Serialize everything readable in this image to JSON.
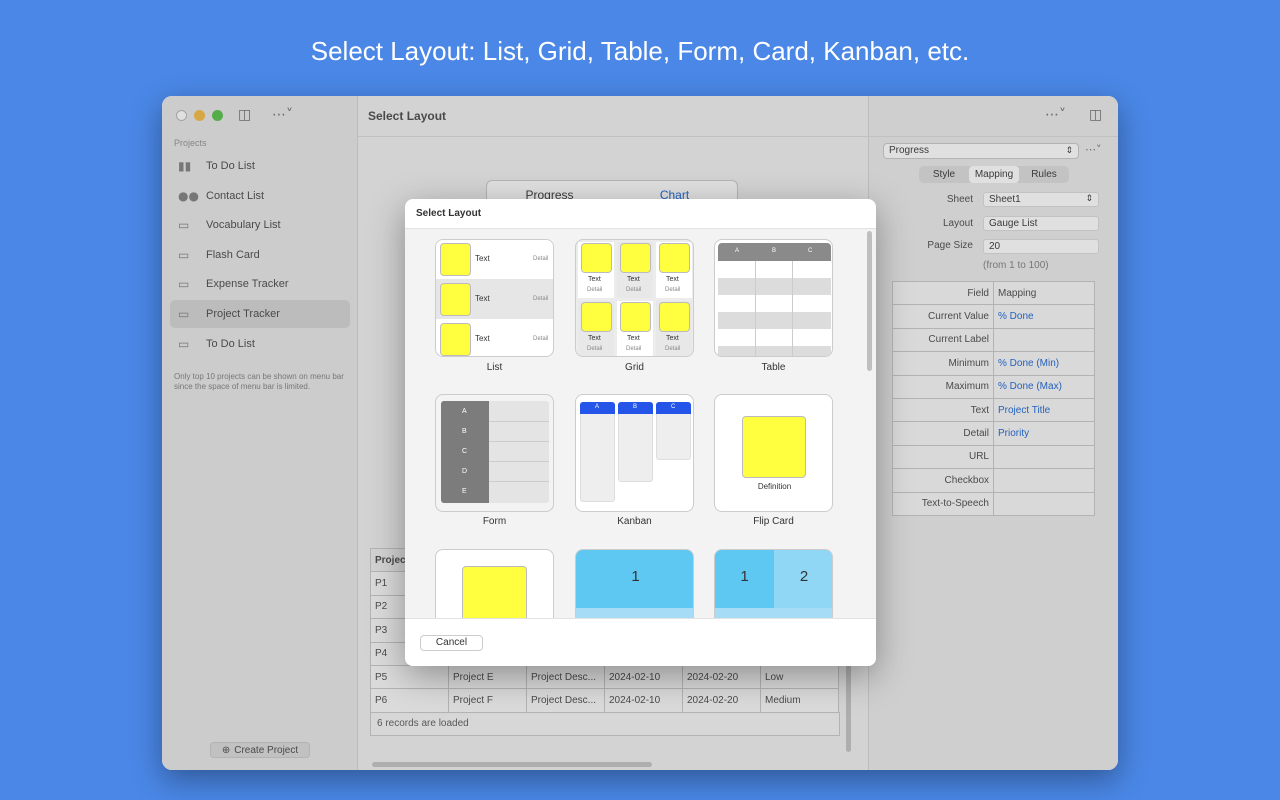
{
  "headline": "Select Layout: List, Grid, Table, Form, Card, Kanban, etc.",
  "colors": {
    "background": "#4a87e6",
    "accent": "#2a6fd6",
    "yellow": "#ffff3f",
    "kanban_header": "#2455e8",
    "card_blue": "#5ec7f2"
  },
  "titlebar_icons": [
    "sidebar-toggle-icon",
    "more-options-icon",
    "inspector-toggle-icon"
  ],
  "sidebar": {
    "section": "Projects",
    "items": [
      {
        "label": "To Do List",
        "icon": "bar-chart-icon"
      },
      {
        "label": "Contact List",
        "icon": "people-icon"
      },
      {
        "label": "Vocabulary List",
        "icon": "folder-icon"
      },
      {
        "label": "Flash Card",
        "icon": "folder-icon"
      },
      {
        "label": "Expense Tracker",
        "icon": "folder-icon"
      },
      {
        "label": "Project Tracker",
        "icon": "folder-icon",
        "selected": true
      },
      {
        "label": "To Do List",
        "icon": "folder-icon"
      }
    ],
    "note": "Only top 10 projects can be shown on menu bar since the space of menu bar is limited.",
    "create_button": "Create Project"
  },
  "main": {
    "title": "Select Layout",
    "segments": [
      "Progress",
      "Chart"
    ],
    "table": {
      "header": "Project",
      "rows": [
        [
          "P1",
          "",
          "",
          "",
          "",
          ""
        ],
        [
          "P2",
          "",
          "",
          "",
          "",
          ""
        ],
        [
          "P3",
          "",
          "",
          "",
          "",
          ""
        ],
        [
          "P4",
          "",
          "",
          "",
          "",
          ""
        ],
        [
          "P5",
          "Project E",
          "Project Desc...",
          "2024-02-10",
          "2024-02-20",
          "Low"
        ],
        [
          "P6",
          "Project F",
          "Project Desc...",
          "2024-02-10",
          "2024-02-20",
          "Medium"
        ]
      ],
      "status": "6 records are loaded"
    }
  },
  "inspector": {
    "selector": "Progress",
    "tabs": [
      "Style",
      "Mapping",
      "Rules"
    ],
    "sheet_label": "Sheet",
    "sheet_value": "Sheet1",
    "layout_label": "Layout",
    "layout_value": "Gauge List",
    "page_size_label": "Page Size",
    "page_size_value": "20",
    "page_size_hint": "(from 1 to 100)",
    "mapping": [
      {
        "field": "Field",
        "mapping": "Mapping",
        "header": true
      },
      {
        "field": "Current Value",
        "mapping": "% Done"
      },
      {
        "field": "Current Label",
        "mapping": ""
      },
      {
        "field": "Minimum",
        "mapping": "% Done (Min)"
      },
      {
        "field": "Maximum",
        "mapping": "% Done (Max)"
      },
      {
        "field": "Text",
        "mapping": "Project Title"
      },
      {
        "field": "Detail",
        "mapping": "Priority"
      },
      {
        "field": "URL",
        "mapping": ""
      },
      {
        "field": "Checkbox",
        "mapping": ""
      },
      {
        "field": "Text-to-Speech",
        "mapping": ""
      }
    ]
  },
  "modal": {
    "title": "Select Layout",
    "cancel": "Cancel",
    "layouts": [
      {
        "name": "List",
        "text": "Text",
        "detail": "Detail"
      },
      {
        "name": "Grid",
        "text": "Text",
        "detail": "Detail"
      },
      {
        "name": "Table",
        "cols": [
          "A",
          "B",
          "C"
        ]
      },
      {
        "name": "Form",
        "rows": [
          "A",
          "B",
          "C",
          "D",
          "E"
        ]
      },
      {
        "name": "Kanban",
        "cols": [
          "A",
          "B",
          "C"
        ]
      },
      {
        "name": "Flip Card",
        "text": "Definition"
      },
      {
        "name": "",
        "text": ""
      },
      {
        "name": "",
        "text": "1"
      },
      {
        "name": "",
        "text": "1",
        "text2": "2"
      }
    ]
  }
}
